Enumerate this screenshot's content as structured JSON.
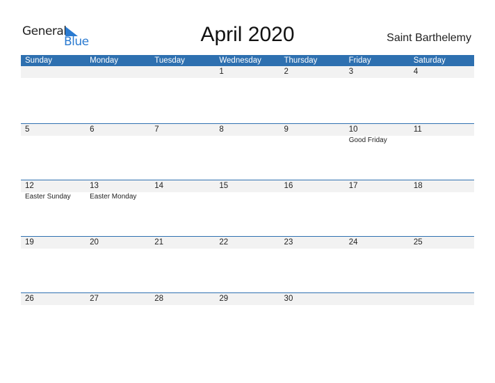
{
  "logo": {
    "word1": "General",
    "word2": "Blue"
  },
  "title": "April 2020",
  "country": "Saint Barthelemy",
  "colors": {
    "header": "#2e70b0",
    "row_bar": "#f2f2f2",
    "logo_blue": "#2a7ad0"
  },
  "weekdays": [
    "Sunday",
    "Monday",
    "Tuesday",
    "Wednesday",
    "Thursday",
    "Friday",
    "Saturday"
  ],
  "weeks": [
    [
      {
        "day": ""
      },
      {
        "day": ""
      },
      {
        "day": ""
      },
      {
        "day": "1"
      },
      {
        "day": "2"
      },
      {
        "day": "3"
      },
      {
        "day": "4"
      }
    ],
    [
      {
        "day": "5"
      },
      {
        "day": "6"
      },
      {
        "day": "7"
      },
      {
        "day": "8"
      },
      {
        "day": "9"
      },
      {
        "day": "10",
        "holiday": "Good Friday"
      },
      {
        "day": "11"
      }
    ],
    [
      {
        "day": "12",
        "holiday": "Easter Sunday"
      },
      {
        "day": "13",
        "holiday": "Easter Monday"
      },
      {
        "day": "14"
      },
      {
        "day": "15"
      },
      {
        "day": "16"
      },
      {
        "day": "17"
      },
      {
        "day": "18"
      }
    ],
    [
      {
        "day": "19"
      },
      {
        "day": "20"
      },
      {
        "day": "21"
      },
      {
        "day": "22"
      },
      {
        "day": "23"
      },
      {
        "day": "24"
      },
      {
        "day": "25"
      }
    ],
    [
      {
        "day": "26"
      },
      {
        "day": "27"
      },
      {
        "day": "28"
      },
      {
        "day": "29"
      },
      {
        "day": "30"
      },
      {
        "day": ""
      },
      {
        "day": ""
      }
    ]
  ]
}
